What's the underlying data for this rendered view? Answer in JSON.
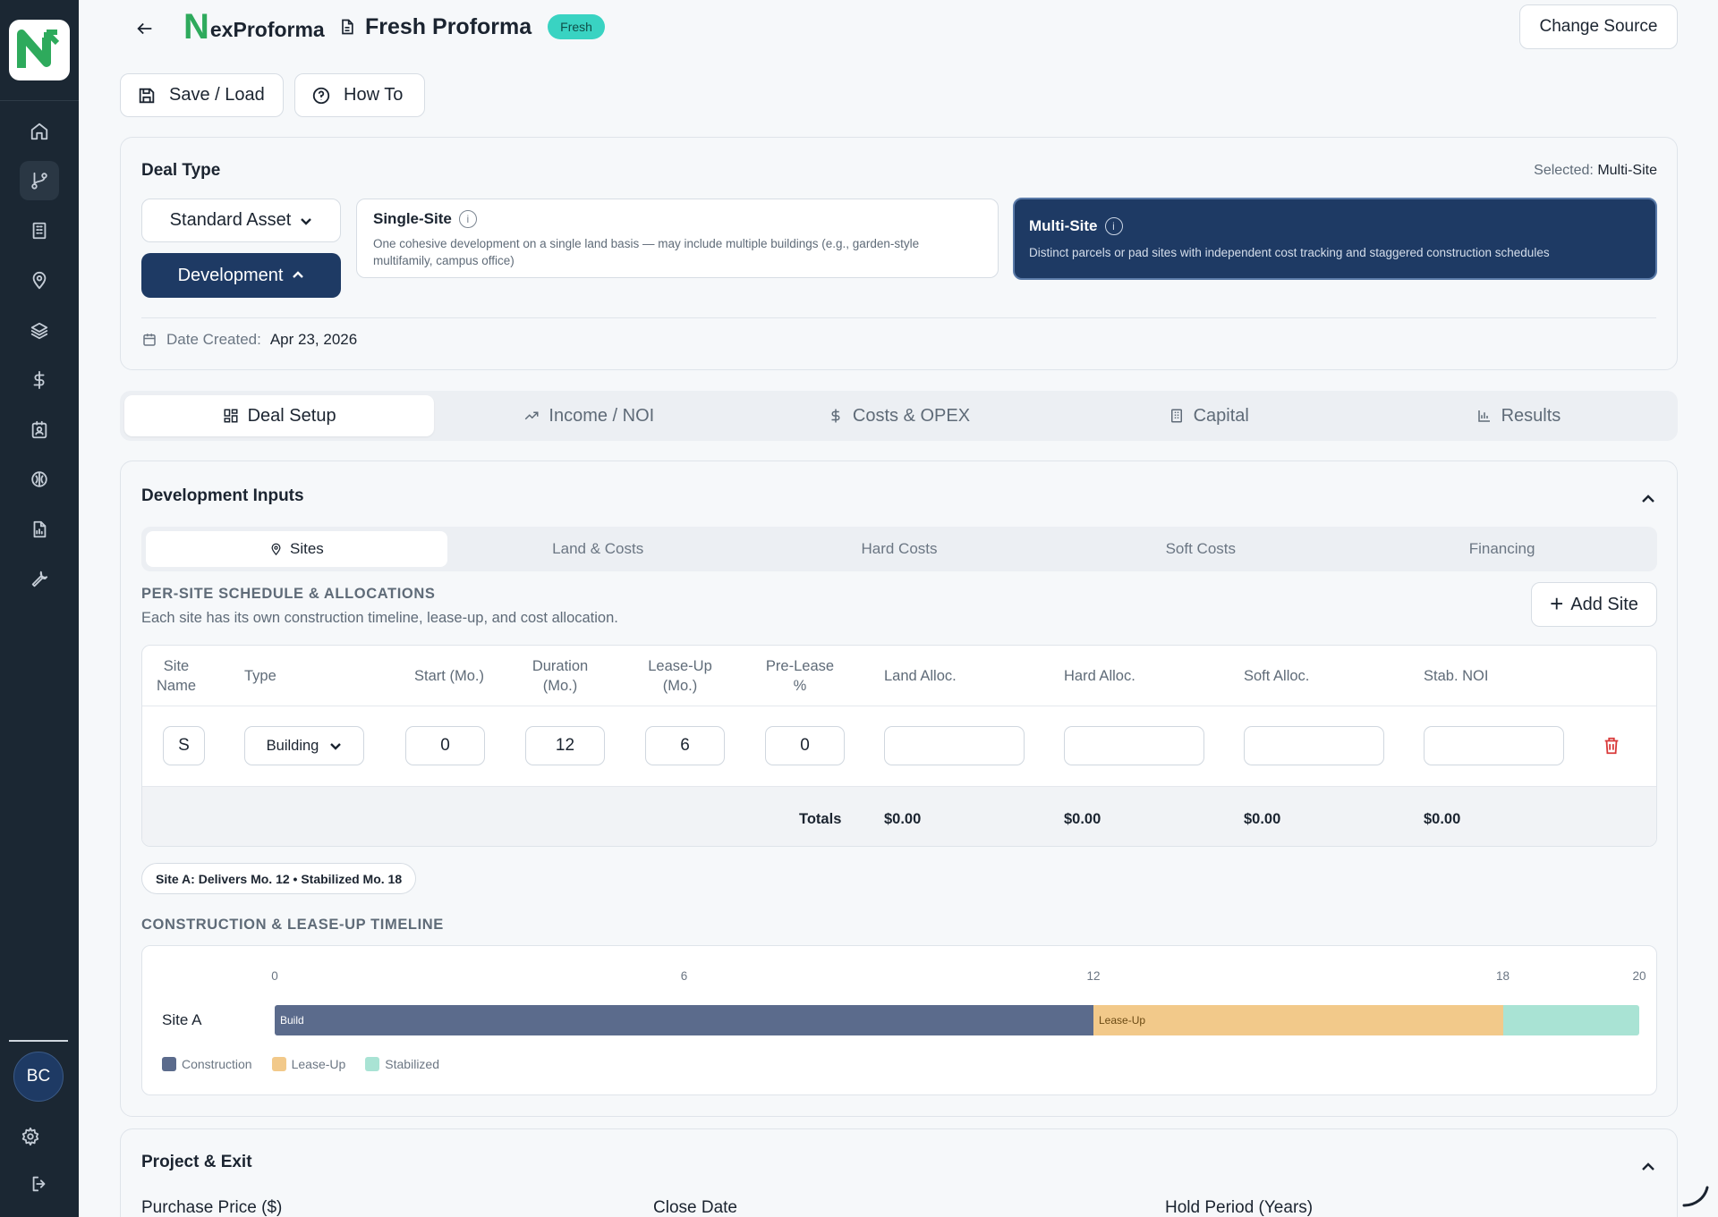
{
  "user": {
    "initials": "BC"
  },
  "header": {
    "brand_initial": "N",
    "brand_rest": "exProforma",
    "doc_title": "Fresh Proforma",
    "badge": "Fresh",
    "change_source": "Change Source"
  },
  "toolbar": {
    "save_load": "Save / Load",
    "how_to": "How To"
  },
  "deal_type": {
    "title": "Deal Type",
    "selected_prefix": "Selected:",
    "selected_value": "Multi-Site",
    "asset_select": "Standard Asset",
    "strategy_select": "Development",
    "single": {
      "name": "Single-Site",
      "desc": "One cohesive development on a single land basis — may include multiple buildings (e.g., garden-style multifamily, campus office)"
    },
    "multi": {
      "name": "Multi-Site",
      "desc": "Distinct parcels or pad sites with independent cost tracking and staggered construction schedules"
    },
    "date_label": "Date Created:",
    "date_value": "Apr 23, 2026"
  },
  "main_tabs": [
    "Deal Setup",
    "Income / NOI",
    "Costs & OPEX",
    "Capital",
    "Results"
  ],
  "dev_inputs": {
    "title": "Development Inputs",
    "sub_tabs": [
      "Sites",
      "Land & Costs",
      "Hard Costs",
      "Soft Costs",
      "Financing"
    ],
    "section_head": "PER-SITE SCHEDULE & ALLOCATIONS",
    "section_desc": "Each site has its own construction timeline, lease-up, and cost allocation.",
    "add_site": "Add Site",
    "columns": {
      "site_name": "Site Name",
      "type": "Type",
      "start": "Start (Mo.)",
      "duration": "Duration (Mo.)",
      "leaseup": "Lease-Up (Mo.)",
      "prelease": "Pre-Lease %",
      "land": "Land Alloc.",
      "hard": "Hard Alloc.",
      "soft": "Soft Alloc.",
      "noi": "Stab. NOI"
    },
    "row": {
      "site_name": "S",
      "type": "Building",
      "start": "0",
      "duration": "12",
      "leaseup": "6",
      "prelease": "0",
      "land": "",
      "hard": "",
      "soft": "",
      "noi": ""
    },
    "totals": {
      "label": "Totals",
      "land": "$0.00",
      "hard": "$0.00",
      "soft": "$0.00",
      "noi": "$0.00"
    },
    "status_pill": "Site A: Delivers Mo. 12 • Stabilized Mo. 18",
    "timeline_head": "CONSTRUCTION & LEASE-UP TIMELINE",
    "timeline": {
      "ticks": [
        "0",
        "6",
        "12",
        "18",
        "20"
      ],
      "max_month": 20,
      "site_label": "Site A",
      "build_label": "Build",
      "lease_label": "Lease-Up",
      "build_start": 0,
      "build_end": 12,
      "lease_end": 18,
      "stab_end": 20,
      "legend": [
        "Construction",
        "Lease-Up",
        "Stabilized"
      ],
      "colors": {
        "construction": "#5b6b8c",
        "leaseup": "#f2c98a",
        "stabilized": "#a9e3d4"
      }
    }
  },
  "project_exit": {
    "title": "Project & Exit",
    "fields": [
      "Purchase Price ($)",
      "Close Date",
      "Hold Period (Years)"
    ]
  }
}
